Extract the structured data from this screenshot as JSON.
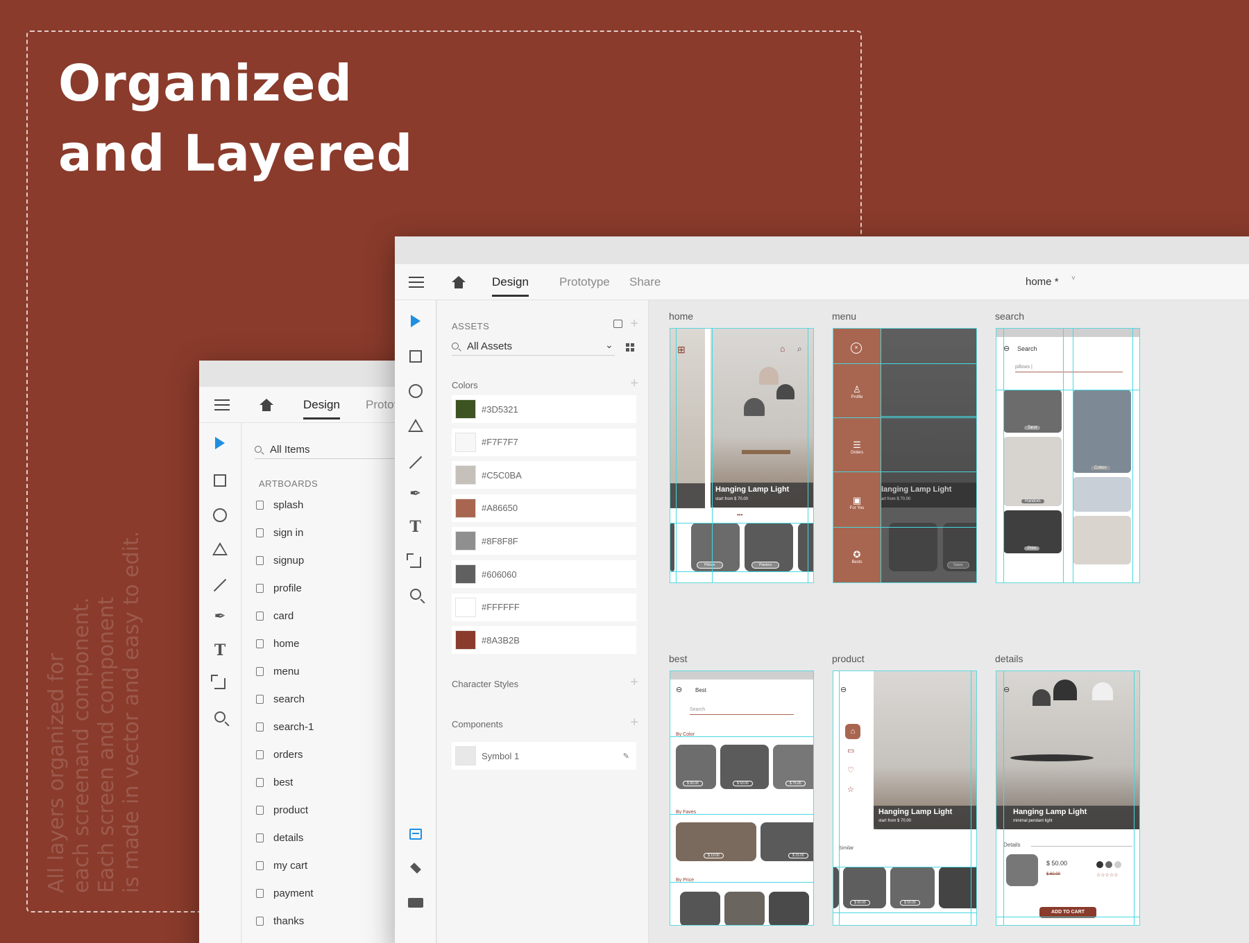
{
  "hero": {
    "line1": "Organized",
    "line2": "and Layered",
    "description_lines": [
      "All layers organized for",
      "each screenand component.",
      "Each screen and component",
      "is made in vector and easy to edit."
    ]
  },
  "back_window": {
    "tabs": [
      "Design",
      "Prototype"
    ],
    "search_label": "All Items",
    "section_label": "ARTBOARDS",
    "artboards": [
      "splash",
      "sign in",
      "signup",
      "profile",
      "card",
      "home",
      "menu",
      "search",
      "search-1",
      "orders",
      "best",
      "product",
      "details",
      "my cart",
      "payment",
      "thanks"
    ]
  },
  "front_window": {
    "tabs": [
      "Design",
      "Prototype",
      "Share"
    ],
    "doc_title": "home *",
    "assets_label": "ASSETS",
    "search_label": "All Assets",
    "colors_title": "Colors",
    "colors": [
      {
        "hex": "#3D5321",
        "label": "#3D5321"
      },
      {
        "hex": "#F7F7F7",
        "label": "#F7F7F7"
      },
      {
        "hex": "#C5C0BA",
        "label": "#C5C0BA"
      },
      {
        "hex": "#A86650",
        "label": "#A86650"
      },
      {
        "hex": "#8F8F8F",
        "label": "#8F8F8F"
      },
      {
        "hex": "#606060",
        "label": "#606060"
      },
      {
        "hex": "#FFFFFF",
        "label": "#FFFFFF"
      },
      {
        "hex": "#8A3B2B",
        "label": "#8A3B2B"
      }
    ],
    "char_styles_title": "Character Styles",
    "components_title": "Components",
    "component_name": "Symbol 1"
  },
  "canvas": {
    "artboards": [
      {
        "label": "home",
        "caption": "Hanging Lamp Light",
        "sub": "start from $ 70.00",
        "chips": [
          "Pillows",
          "Planters"
        ]
      },
      {
        "label": "menu",
        "caption": "langing Lamp Light",
        "sub": "art from $ 70.00",
        "menu": [
          "Profile",
          "Orders",
          "For You",
          "Bests"
        ],
        "chips": [
          "Vases"
        ]
      },
      {
        "label": "search",
        "title": "Search",
        "query": "pillows |",
        "tiles": [
          "Tarot",
          "Cotton",
          "Random",
          "Prim"
        ]
      },
      {
        "label": "best",
        "title": "Best",
        "placeholder": "Search",
        "sections": [
          "By Color",
          "By Faves",
          "By Price"
        ],
        "prices": [
          "$ 90.00",
          "$ 50.00",
          "$ 75.00",
          "$ 19.00",
          "$ 15.00"
        ]
      },
      {
        "label": "product",
        "caption": "Hanging Lamp Light",
        "sub": "start from $ 70.00",
        "similar": "Similar",
        "prices": [
          "$ 90.00",
          "$ 50.00"
        ]
      },
      {
        "label": "details",
        "caption": "Hanging Lamp Light",
        "sub": "minimal pendant light",
        "details": "Details",
        "price": "$ 50.00",
        "old_price": "$ 60.00",
        "cart": "ADD TO CART"
      }
    ]
  },
  "colors": {
    "brand": "#8A3B2B",
    "accent": "#1E8FE1",
    "guide": "#45D8E2"
  }
}
